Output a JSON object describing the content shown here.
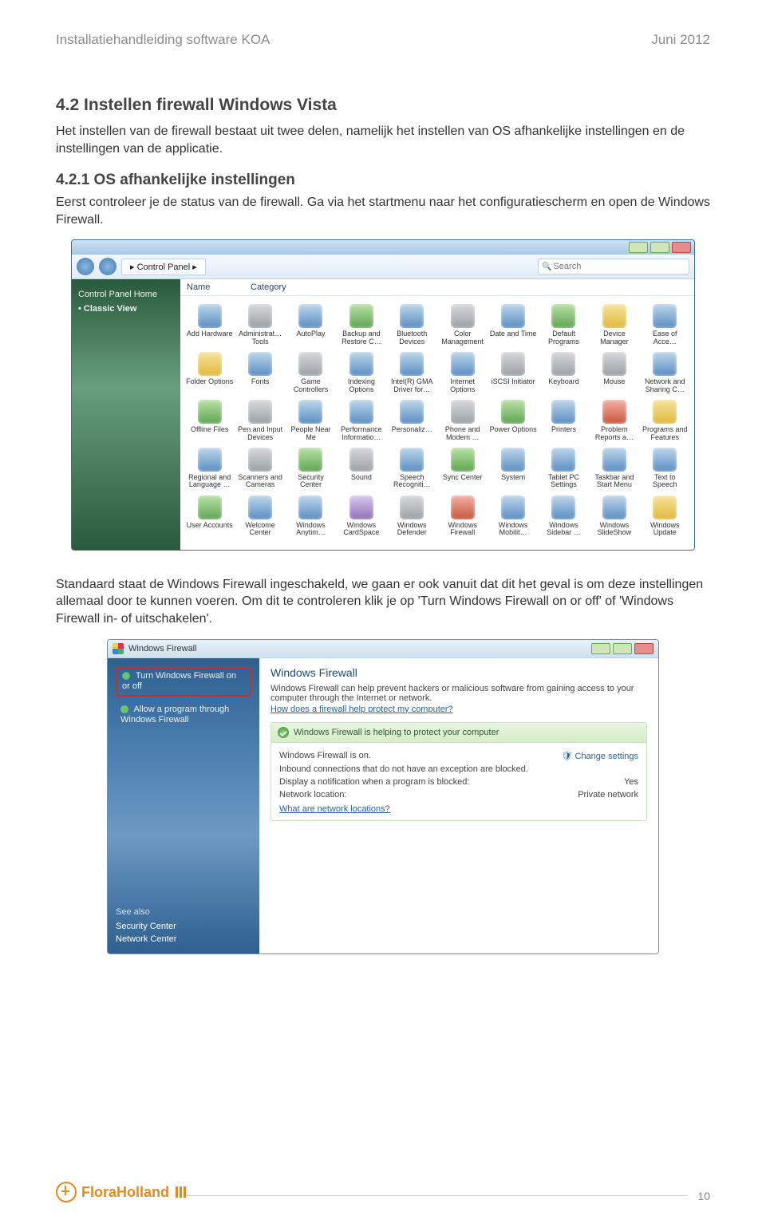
{
  "header": {
    "left": "Installatiehandleiding software KOA",
    "right": "Juni 2012"
  },
  "section": {
    "heading": "4.2  Instellen firewall Windows Vista",
    "intro": "Het instellen van de firewall bestaat uit twee delen, namelijk het instellen van OS afhankelijke instellingen en de instellingen van de applicatie.",
    "sub_heading": "4.2.1  OS afhankelijke instellingen",
    "sub_intro": "Eerst controleer je de status van de firewall. Ga via het startmenu naar het configuratiescherm en open de Windows Firewall.",
    "post_cp": "Standaard staat de Windows Firewall ingeschakeld, we gaan er ook vanuit dat dit het geval is om deze instellingen allemaal door te kunnen voeren. Om dit te controleren klik je op 'Turn Windows Firewall on or off' of 'Windows Firewall in- of uitschakelen'."
  },
  "control_panel": {
    "breadcrumb": "Control Panel",
    "search_placeholder": "Search",
    "sidebar": {
      "home": "Control Panel Home",
      "classic": "Classic View"
    },
    "columns": {
      "name": "Name",
      "category": "Category"
    },
    "items": [
      {
        "l": "Add Hardware",
        "c": "blu"
      },
      {
        "l": "Administrat… Tools",
        "c": "gry"
      },
      {
        "l": "AutoPlay",
        "c": "blu"
      },
      {
        "l": "Backup and Restore C…",
        "c": "grn"
      },
      {
        "l": "Bluetooth Devices",
        "c": "blu"
      },
      {
        "l": "Color Management",
        "c": "gry"
      },
      {
        "l": "Date and Time",
        "c": "blu"
      },
      {
        "l": "Default Programs",
        "c": "grn"
      },
      {
        "l": "Device Manager",
        "c": "ylw"
      },
      {
        "l": "Ease of Acce…",
        "c": "blu"
      },
      {
        "l": "Folder Options",
        "c": "ylw"
      },
      {
        "l": "Fonts",
        "c": "blu"
      },
      {
        "l": "Game Controllers",
        "c": "gry"
      },
      {
        "l": "Indexing Options",
        "c": "blu"
      },
      {
        "l": "Intel(R) GMA Driver for…",
        "c": "blu"
      },
      {
        "l": "Internet Options",
        "c": "blu"
      },
      {
        "l": "iSCSI Initiator",
        "c": "gry"
      },
      {
        "l": "Keyboard",
        "c": "gry"
      },
      {
        "l": "Mouse",
        "c": "gry"
      },
      {
        "l": "Network and Sharing C…",
        "c": "blu"
      },
      {
        "l": "Offline Files",
        "c": "grn"
      },
      {
        "l": "Pen and Input Devices",
        "c": "gry"
      },
      {
        "l": "People Near Me",
        "c": "blu"
      },
      {
        "l": "Performance Informatio…",
        "c": "blu"
      },
      {
        "l": "Personaliz…",
        "c": "blu"
      },
      {
        "l": "Phone and Modem …",
        "c": "gry"
      },
      {
        "l": "Power Options",
        "c": "grn"
      },
      {
        "l": "Printers",
        "c": "blu"
      },
      {
        "l": "Problem Reports a…",
        "c": "red"
      },
      {
        "l": "Programs and Features",
        "c": "ylw"
      },
      {
        "l": "Regional and Language …",
        "c": "blu"
      },
      {
        "l": "Scanners and Cameras",
        "c": "gry"
      },
      {
        "l": "Security Center",
        "c": "grn"
      },
      {
        "l": "Sound",
        "c": "gry"
      },
      {
        "l": "Speech Recogniti…",
        "c": "blu"
      },
      {
        "l": "Sync Center",
        "c": "grn"
      },
      {
        "l": "System",
        "c": "blu"
      },
      {
        "l": "Tablet PC Settings",
        "c": "blu"
      },
      {
        "l": "Taskbar and Start Menu",
        "c": "blu"
      },
      {
        "l": "Text to Speech",
        "c": "blu"
      },
      {
        "l": "User Accounts",
        "c": "grn"
      },
      {
        "l": "Welcome Center",
        "c": "blu"
      },
      {
        "l": "Windows Anytim…",
        "c": "blu"
      },
      {
        "l": "Windows CardSpace",
        "c": "pur"
      },
      {
        "l": "Windows Defender",
        "c": "gry"
      },
      {
        "l": "Windows Firewall",
        "c": "red"
      },
      {
        "l": "Windows Mobilit…",
        "c": "blu"
      },
      {
        "l": "Windows Sidebar …",
        "c": "blu"
      },
      {
        "l": "Windows SlideShow",
        "c": "blu"
      },
      {
        "l": "Windows Update",
        "c": "ylw"
      }
    ]
  },
  "firewall": {
    "title": "Windows Firewall",
    "tasks": {
      "turn": "Turn Windows Firewall on or off",
      "allow": "Allow a program through Windows Firewall"
    },
    "see_also": {
      "heading": "See also",
      "sec": "Security Center",
      "net": "Network Center"
    },
    "main": {
      "heading": "Windows Firewall",
      "desc": "Windows Firewall can help prevent hackers or malicious software from gaining access to your computer through the Internet or network.",
      "help": "How does a firewall help protect my computer?",
      "status_banner": "Windows Firewall is helping to protect your computer",
      "rows": {
        "on_l": "Windows Firewall is on.",
        "on_r": "Change settings",
        "inbound": "Inbound connections that do not have an exception are blocked.",
        "notify_l": "Display a notification when a program is blocked:",
        "notify_r": "Yes",
        "netloc_l": "Network location:",
        "netloc_r": "Private network",
        "help2": "What are network locations?"
      }
    }
  },
  "footer": {
    "brand": "FloraHolland",
    "pageno": "10"
  }
}
